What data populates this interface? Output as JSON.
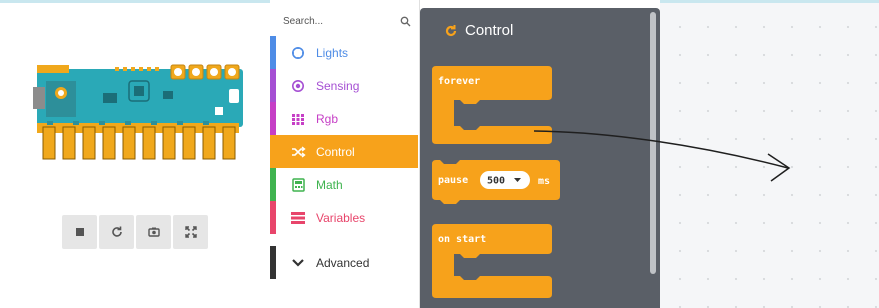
{
  "colors": {
    "control": "#f7a21b",
    "lights": "#4e8ce6",
    "sensing": "#a54fd3",
    "rgb": "#c63fc6",
    "math": "#3fb34f",
    "variables": "#e8456b",
    "flyout_bg": "#5a5f67",
    "workspace_bg": "#f5f6f8",
    "board_pcb": "#2aa9b7",
    "board_pads": "#f0a81c"
  },
  "simulator": {
    "toolbar": {
      "stop_icon": "stop-icon",
      "restart_icon": "restart-icon",
      "screenshot_icon": "camera-icon",
      "fullscreen_icon": "fullscreen-icon"
    }
  },
  "toolbox": {
    "search": {
      "placeholder": "Search..."
    },
    "categories": [
      {
        "label": "Lights",
        "icon": "lights-icon"
      },
      {
        "label": "Sensing",
        "icon": "sensing-icon"
      },
      {
        "label": "Rgb",
        "icon": "grid-icon"
      },
      {
        "label": "Control",
        "icon": "shuffle-icon"
      },
      {
        "label": "Math",
        "icon": "calculator-icon"
      },
      {
        "label": "Variables",
        "icon": "list-icon"
      }
    ],
    "advanced": {
      "label": "Advanced",
      "icon": "chevron-down-icon"
    }
  },
  "flyout": {
    "title": "Control",
    "blocks": {
      "forever": {
        "label": "forever"
      },
      "pause": {
        "label": "pause",
        "value": "500",
        "unit": "ms"
      },
      "on_start": {
        "label": "on start"
      }
    }
  }
}
